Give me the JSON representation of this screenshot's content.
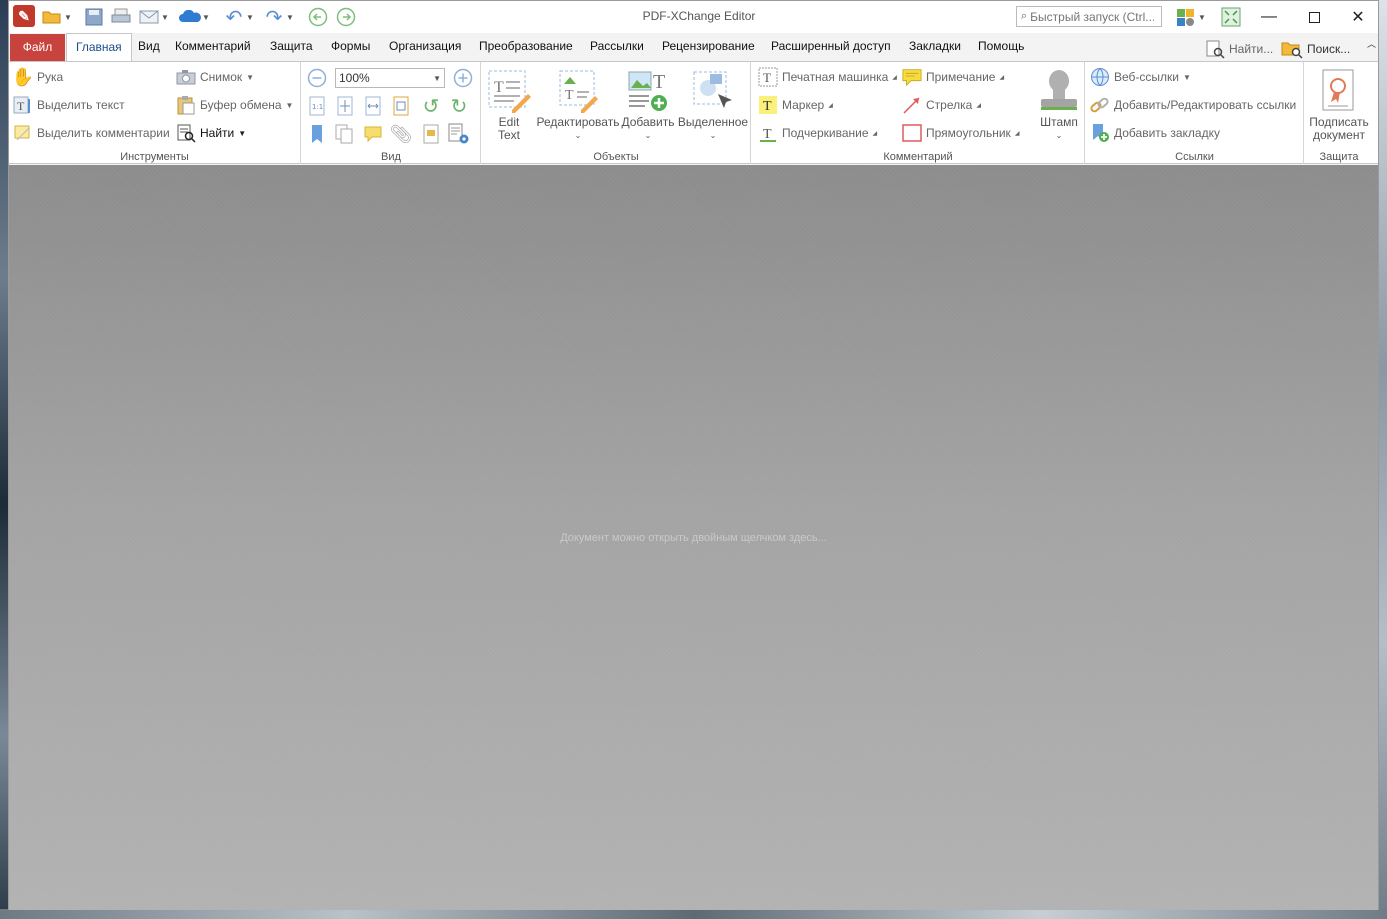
{
  "window": {
    "title": "PDF-XChange Editor",
    "quick_launch_placeholder": "Быстрый запуск (Ctrl..."
  },
  "menu": {
    "file": "Файл",
    "tabs": [
      "Главная",
      "Вид",
      "Комментарий",
      "Защита",
      "Формы",
      "Организация",
      "Преобразование",
      "Рассылки",
      "Рецензирование",
      "Расширенный доступ",
      "Закладки",
      "Помощь"
    ],
    "active_tab": "Главная",
    "find": "Найти...",
    "search": "Поиск..."
  },
  "ribbon": {
    "tools": {
      "label": "Инструменты",
      "hand": "Рука",
      "select_text": "Выделить текст",
      "select_comments": "Выделить комментарии",
      "snapshot": "Снимок",
      "clipboard": "Буфер обмена",
      "find": "Найти"
    },
    "view": {
      "label": "Вид",
      "zoom": "100%"
    },
    "objects": {
      "label": "Объекты",
      "edit_text_line1": "Edit",
      "edit_text_line2": "Text",
      "edit": "Редактировать",
      "add": "Добавить",
      "selected": "Выделенное"
    },
    "comment": {
      "label": "Комментарий",
      "typewriter": "Печатная машинка",
      "marker": "Маркер",
      "underline": "Подчеркивание",
      "note": "Примечание",
      "arrow": "Стрелка",
      "rectangle": "Прямоугольник",
      "stamp": "Штамп"
    },
    "links": {
      "label": "Ссылки",
      "web_links": "Веб-ссылки",
      "add_edit_links": "Добавить/Редактировать ссылки",
      "add_bookmark": "Добавить закладку"
    },
    "protection": {
      "label": "Защита",
      "sign_line1": "Подписать",
      "sign_line2": "документ"
    }
  },
  "workspace": {
    "hint": "Документ можно открыть двойным щелчком здесь..."
  },
  "colors": {
    "file_tab": "#c8433e",
    "active_tab_text": "#1a4f8b",
    "workspace": "#a3a3a3"
  }
}
